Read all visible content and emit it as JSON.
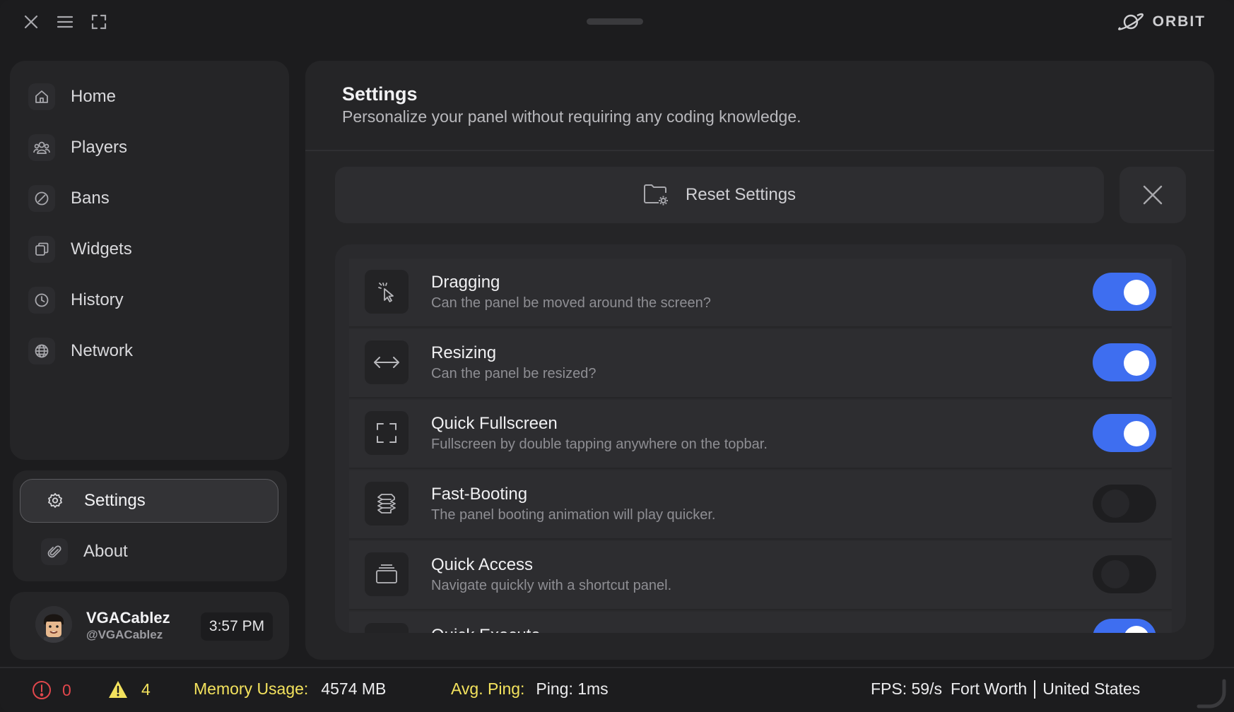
{
  "brand": {
    "name": "ORBIT"
  },
  "sidebar": {
    "items": [
      {
        "label": "Home",
        "icon": "home-icon"
      },
      {
        "label": "Players",
        "icon": "players-icon"
      },
      {
        "label": "Bans",
        "icon": "ban-icon"
      },
      {
        "label": "Widgets",
        "icon": "widgets-icon"
      },
      {
        "label": "History",
        "icon": "clock-icon"
      },
      {
        "label": "Network",
        "icon": "globe-icon"
      }
    ],
    "settings_label": "Settings",
    "about_label": "About"
  },
  "user": {
    "name": "VGACablez",
    "handle": "@VGACablez",
    "time": "3:57 PM"
  },
  "main": {
    "title": "Settings",
    "subtitle": "Personalize your panel without requiring any coding knowledge.",
    "reset_label": "Reset Settings",
    "settings": [
      {
        "title": "Dragging",
        "desc": "Can the panel be moved around the screen?",
        "enabled": true,
        "icon": "pointer-click-icon"
      },
      {
        "title": "Resizing",
        "desc": "Can the panel be resized?",
        "enabled": true,
        "icon": "arrows-horizontal-icon"
      },
      {
        "title": "Quick Fullscreen",
        "desc": "Fullscreen by double tapping anywhere on the topbar.",
        "enabled": true,
        "icon": "fullscreen-icon"
      },
      {
        "title": "Fast-Booting",
        "desc": "The panel booting animation will play quicker.",
        "enabled": false,
        "icon": "layers-wave-icon"
      },
      {
        "title": "Quick Access",
        "desc": "Navigate quickly with a shortcut panel.",
        "enabled": false,
        "icon": "stack-icon"
      },
      {
        "title": "Quick Execute",
        "desc": "",
        "enabled": true,
        "icon": "execute-icon"
      }
    ]
  },
  "status": {
    "errors": "0",
    "warnings": "4",
    "memory_label": "Memory Usage:",
    "memory_value": "4574 MB",
    "ping_label": "Avg. Ping:",
    "ping_value": "Ping: 1ms",
    "fps": "FPS: 59/s",
    "location": "Fort Worth",
    "country": "United States"
  },
  "colors": {
    "accent": "#3e6ef0",
    "warning": "#f3e25d",
    "error": "#e0474c"
  }
}
